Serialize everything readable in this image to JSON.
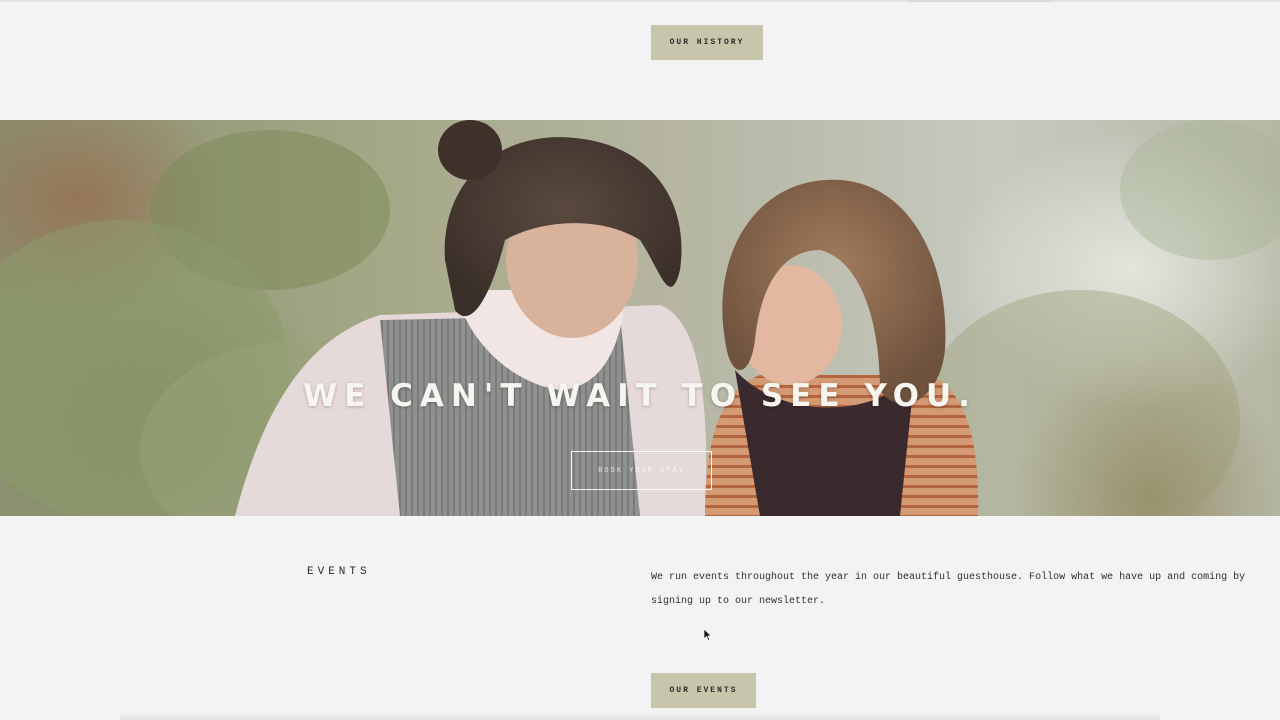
{
  "history_button": {
    "label": "OUR HISTORY"
  },
  "hero": {
    "title": "WE CAN'T WAIT TO SEE YOU.",
    "book_button": "BOOK YOUR STAY"
  },
  "events": {
    "heading": "EVENTS",
    "description": "We run events throughout the year in our beautiful guesthouse. Follow what we have up and coming by signing up to our newsletter.",
    "button": "OUR EVENTS"
  },
  "colors": {
    "page_background": "#f3f3f3",
    "button_khaki": "#c8c5ad"
  },
  "icons": [
    "mouse-cursor-icon"
  ]
}
